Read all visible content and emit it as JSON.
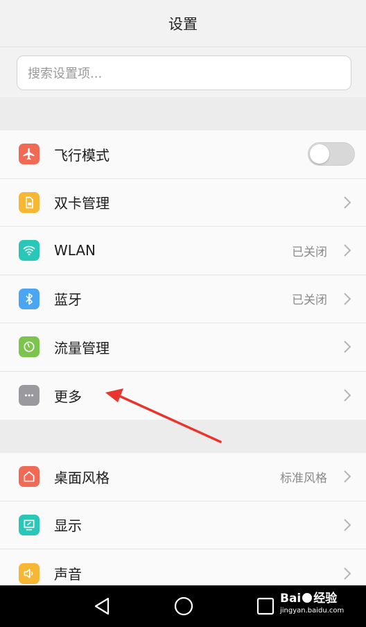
{
  "header": {
    "title": "设置"
  },
  "search": {
    "placeholder": "搜索设置项..."
  },
  "group1": [
    {
      "id": "airplane",
      "label": "飞行模式",
      "icon": "airplane-icon",
      "color": "#f16a55",
      "toggle": true,
      "on": false
    },
    {
      "id": "dualsim",
      "label": "双卡管理",
      "icon": "sim-card-icon",
      "color": "#f7b733"
    },
    {
      "id": "wlan",
      "label": "WLAN",
      "icon": "wifi-icon",
      "color": "#28c7b7",
      "status": "已关闭"
    },
    {
      "id": "bluetooth",
      "label": "蓝牙",
      "icon": "bluetooth-icon",
      "color": "#4aa6f2",
      "status": "已关闭"
    },
    {
      "id": "data",
      "label": "流量管理",
      "icon": "gauge-icon",
      "color": "#7cc44d"
    },
    {
      "id": "more",
      "label": "更多",
      "icon": "more-dots-icon",
      "color": "#9a9a9e"
    }
  ],
  "group2": [
    {
      "id": "theme",
      "label": "桌面风格",
      "icon": "home-icon",
      "color": "#f16a55",
      "status": "标准风格"
    },
    {
      "id": "display",
      "label": "显示",
      "icon": "display-icon",
      "color": "#28c7b7"
    },
    {
      "id": "sound",
      "label": "声音",
      "icon": "speaker-icon",
      "color": "#f7b733"
    }
  ],
  "navbar": {
    "back_icon": "back-triangle-icon",
    "home_icon": "home-circle-icon",
    "recent_icon": "recent-square-icon"
  },
  "watermark": {
    "brand": "Bai",
    "brand_suffix": "经验",
    "url": "jingyan.baidu.com"
  },
  "annotation": {
    "arrow_color": "#e8352e"
  }
}
